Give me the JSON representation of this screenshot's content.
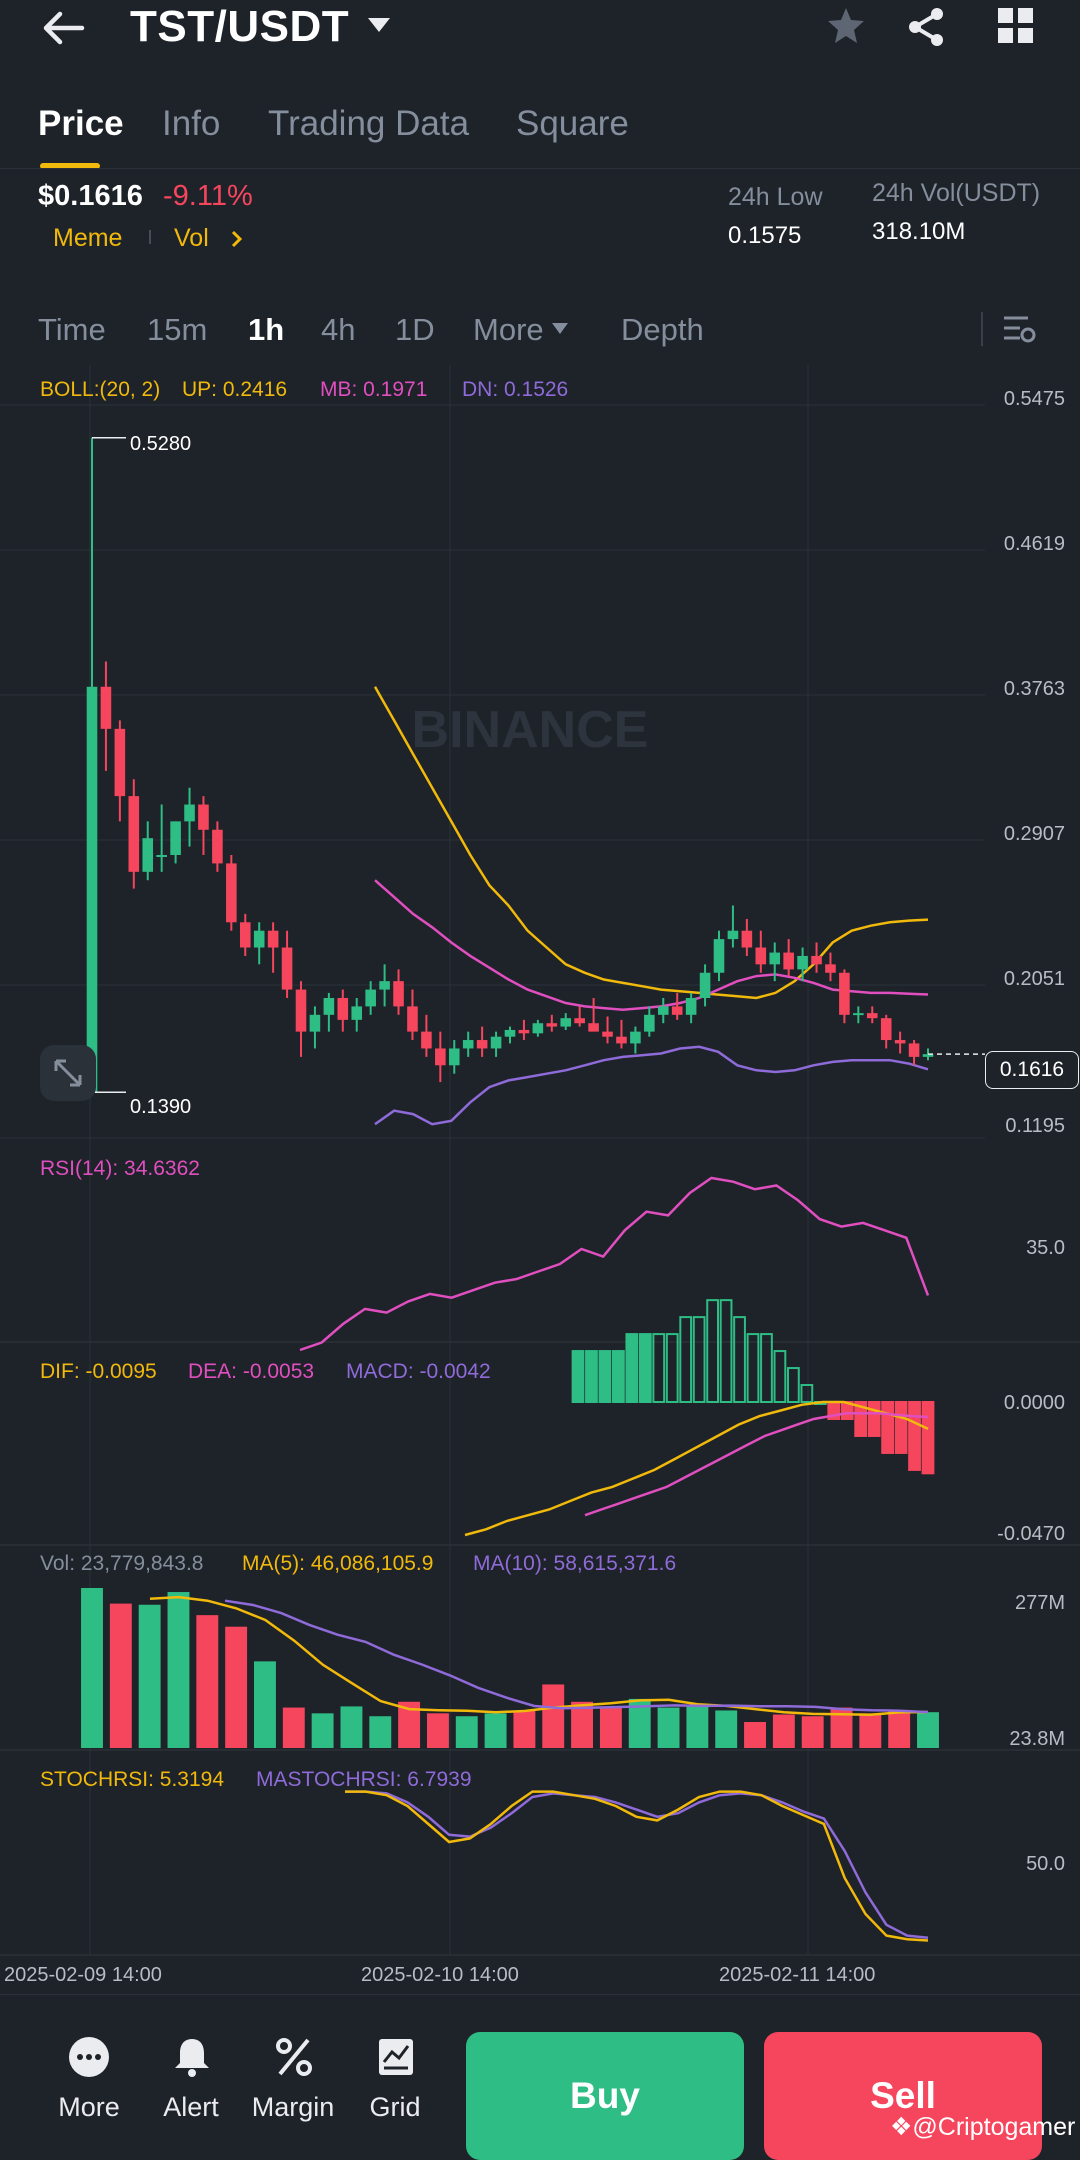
{
  "header": {
    "pair": "TST/USDT",
    "icons": [
      "back-arrow-icon",
      "caret-down-icon",
      "star-icon",
      "share-icon",
      "grid-icon"
    ]
  },
  "tabs": [
    {
      "label": "Price",
      "active": true
    },
    {
      "label": "Info",
      "active": false
    },
    {
      "label": "Trading Data",
      "active": false
    },
    {
      "label": "Square",
      "active": false
    }
  ],
  "ticker": {
    "price": "$0.1616",
    "change": "-9.11%",
    "tag1": "Meme",
    "tag2": "Vol",
    "low_label": "24h Low",
    "low_value": "0.1575",
    "vol_label": "24h Vol(USDT)",
    "vol_value": "318.10M"
  },
  "timeframes": {
    "items": [
      "Time",
      "15m",
      "1h",
      "4h",
      "1D",
      "More",
      "Depth"
    ],
    "active": "1h"
  },
  "indicators": {
    "boll": {
      "label": "BOLL:(20, 2)",
      "up": "UP: 0.2416",
      "mb": "MB: 0.1971",
      "dn": "DN: 0.1526"
    },
    "rsi": "RSI(14): 34.6362",
    "macd": {
      "dif": "DIF: -0.0095",
      "dea": "DEA: -0.0053",
      "macd": "MACD: -0.0042"
    },
    "vol": {
      "vol": "Vol: 23,779,843.8",
      "ma5": "MA(5): 46,086,105.9",
      "ma10": "MA(10): 58,615,371.6"
    },
    "stoch": {
      "stoch": "STOCHRSI: 5.3194",
      "ma": "MASTOCHRSI: 6.7939"
    }
  },
  "axis": {
    "price": [
      "0.5475",
      "0.4619",
      "0.3763",
      "0.2907",
      "0.2051",
      "0.1195"
    ],
    "current": "0.1616",
    "high_marker": "0.5280",
    "low_marker": "0.1390",
    "rsi": "35.0",
    "macd_top": "0.0000",
    "macd_bottom": "-0.0470",
    "vol_top": "277M",
    "vol_bottom": "23.8M",
    "stoch": "50.0"
  },
  "dates": [
    "2025-02-09 14:00",
    "2025-02-10 14:00",
    "2025-02-11 14:00"
  ],
  "watermark": "BINANCE",
  "bottom_nav": [
    {
      "label": "More",
      "icon": "more-dots-icon"
    },
    {
      "label": "Alert",
      "icon": "bell-icon"
    },
    {
      "label": "Margin",
      "icon": "margin-percent-icon"
    },
    {
      "label": "Grid",
      "icon": "grid-bot-icon"
    }
  ],
  "actions": {
    "buy": "Buy",
    "sell": "Sell"
  },
  "credit": "@Criptogamer",
  "colors": {
    "up": "#2ebd85",
    "down": "#f6465d",
    "accent": "#f0b90b",
    "boll_mb": "#e04fbf",
    "boll_dn": "#8e6bd8"
  },
  "chart_data": {
    "type": "candlestick",
    "x_labels": [
      "2025-02-09 14:00",
      "2025-02-10 14:00",
      "2025-02-11 14:00"
    ],
    "ylim": [
      0.1195,
      0.5475
    ],
    "candles": [
      [
        0.139,
        0.528,
        0.139,
        0.38
      ],
      [
        0.38,
        0.395,
        0.33,
        0.355
      ],
      [
        0.355,
        0.36,
        0.3,
        0.315
      ],
      [
        0.315,
        0.325,
        0.26,
        0.27
      ],
      [
        0.27,
        0.3,
        0.265,
        0.29
      ],
      [
        0.28,
        0.31,
        0.27,
        0.28
      ],
      [
        0.28,
        0.3,
        0.275,
        0.3
      ],
      [
        0.3,
        0.32,
        0.285,
        0.31
      ],
      [
        0.31,
        0.315,
        0.28,
        0.295
      ],
      [
        0.295,
        0.3,
        0.27,
        0.275
      ],
      [
        0.275,
        0.28,
        0.235,
        0.24
      ],
      [
        0.24,
        0.245,
        0.22,
        0.225
      ],
      [
        0.225,
        0.24,
        0.215,
        0.235
      ],
      [
        0.235,
        0.24,
        0.21,
        0.225
      ],
      [
        0.225,
        0.235,
        0.195,
        0.2
      ],
      [
        0.2,
        0.205,
        0.16,
        0.175
      ],
      [
        0.175,
        0.19,
        0.165,
        0.185
      ],
      [
        0.185,
        0.198,
        0.175,
        0.195
      ],
      [
        0.195,
        0.2,
        0.175,
        0.182
      ],
      [
        0.182,
        0.195,
        0.175,
        0.19
      ],
      [
        0.19,
        0.205,
        0.185,
        0.2
      ],
      [
        0.2,
        0.215,
        0.19,
        0.205
      ],
      [
        0.205,
        0.212,
        0.185,
        0.19
      ],
      [
        0.19,
        0.2,
        0.17,
        0.175
      ],
      [
        0.175,
        0.185,
        0.16,
        0.165
      ],
      [
        0.165,
        0.175,
        0.145,
        0.155
      ],
      [
        0.155,
        0.17,
        0.15,
        0.165
      ],
      [
        0.165,
        0.175,
        0.16,
        0.17
      ],
      [
        0.17,
        0.178,
        0.16,
        0.165
      ],
      [
        0.165,
        0.175,
        0.16,
        0.172
      ],
      [
        0.172,
        0.178,
        0.168,
        0.176
      ],
      [
        0.176,
        0.182,
        0.17,
        0.174
      ],
      [
        0.174,
        0.182,
        0.172,
        0.18
      ],
      [
        0.18,
        0.185,
        0.175,
        0.178
      ],
      [
        0.178,
        0.186,
        0.176,
        0.183
      ],
      [
        0.183,
        0.19,
        0.178,
        0.18
      ],
      [
        0.18,
        0.195,
        0.178,
        0.175
      ],
      [
        0.175,
        0.184,
        0.168,
        0.172
      ],
      [
        0.172,
        0.182,
        0.165,
        0.168
      ],
      [
        0.168,
        0.178,
        0.162,
        0.175
      ],
      [
        0.175,
        0.19,
        0.172,
        0.185
      ],
      [
        0.185,
        0.195,
        0.18,
        0.19
      ],
      [
        0.19,
        0.198,
        0.182,
        0.185
      ],
      [
        0.185,
        0.198,
        0.18,
        0.195
      ],
      [
        0.195,
        0.215,
        0.19,
        0.21
      ],
      [
        0.21,
        0.235,
        0.205,
        0.23
      ],
      [
        0.23,
        0.25,
        0.225,
        0.235
      ],
      [
        0.235,
        0.242,
        0.22,
        0.225
      ],
      [
        0.225,
        0.235,
        0.21,
        0.215
      ],
      [
        0.215,
        0.228,
        0.205,
        0.222
      ],
      [
        0.222,
        0.23,
        0.208,
        0.212
      ],
      [
        0.212,
        0.225,
        0.205,
        0.22
      ],
      [
        0.22,
        0.228,
        0.21,
        0.215
      ],
      [
        0.215,
        0.222,
        0.205,
        0.21
      ],
      [
        0.21,
        0.212,
        0.18,
        0.185
      ],
      [
        0.185,
        0.19,
        0.18,
        0.186
      ],
      [
        0.186,
        0.19,
        0.18,
        0.183
      ],
      [
        0.183,
        0.185,
        0.165,
        0.17
      ],
      [
        0.17,
        0.175,
        0.162,
        0.168
      ],
      [
        0.168,
        0.17,
        0.155,
        0.16
      ],
      [
        0.16,
        0.165,
        0.158,
        0.1616
      ]
    ],
    "boll_upper": [
      0.38,
      0.36,
      0.34,
      0.32,
      0.3,
      0.28,
      0.262,
      0.25,
      0.235,
      0.225,
      0.215,
      0.21,
      0.206,
      0.204,
      0.202,
      0.2,
      0.199,
      0.198,
      0.197,
      0.196,
      0.195,
      0.198,
      0.205,
      0.215,
      0.228,
      0.235,
      0.238,
      0.24,
      0.241,
      0.2416
    ],
    "boll_mid": [
      0.265,
      0.255,
      0.245,
      0.237,
      0.228,
      0.22,
      0.213,
      0.206,
      0.2,
      0.196,
      0.192,
      0.19,
      0.189,
      0.188,
      0.189,
      0.19,
      0.192,
      0.195,
      0.2,
      0.205,
      0.208,
      0.209,
      0.207,
      0.204,
      0.2,
      0.199,
      0.198,
      0.198,
      0.1975,
      0.1971
    ],
    "boll_lower": [
      0.12,
      0.128,
      0.126,
      0.12,
      0.122,
      0.133,
      0.142,
      0.146,
      0.148,
      0.15,
      0.152,
      0.155,
      0.158,
      0.16,
      0.161,
      0.162,
      0.165,
      0.166,
      0.163,
      0.155,
      0.152,
      0.151,
      0.152,
      0.155,
      0.157,
      0.158,
      0.158,
      0.158,
      0.156,
      0.1526
    ],
    "rsi": [
      20,
      22,
      27,
      31,
      30,
      33,
      35,
      34,
      36,
      38,
      39,
      41,
      43,
      47,
      45,
      52,
      57,
      56,
      62,
      66,
      65,
      63,
      64,
      60,
      55,
      53,
      54,
      52,
      50,
      34.6
    ],
    "macd_dif": [
      -0.047,
      -0.045,
      -0.042,
      -0.04,
      -0.038,
      -0.035,
      -0.032,
      -0.03,
      -0.027,
      -0.024,
      -0.02,
      -0.016,
      -0.012,
      -0.008,
      -0.005,
      -0.003,
      -0.001,
      0.0,
      0.0,
      -0.002,
      -0.004,
      -0.006,
      -0.0095
    ],
    "macd_dea": [
      -0.04,
      -0.038,
      -0.036,
      -0.034,
      -0.032,
      -0.03,
      -0.027,
      -0.024,
      -0.021,
      -0.018,
      -0.015,
      -0.012,
      -0.01,
      -0.008,
      -0.006,
      -0.005,
      -0.004,
      -0.004,
      -0.004,
      -0.0045,
      -0.005,
      -0.0053
    ],
    "macd_hist": [
      0.003,
      0.003,
      0.003,
      0.003,
      0.004,
      0.004,
      0.004,
      0.004,
      0.005,
      0.005,
      0.006,
      0.006,
      0.005,
      0.004,
      0.004,
      0.003,
      0.002,
      0.001,
      0.0,
      -0.001,
      -0.001,
      -0.002,
      -0.002,
      -0.003,
      -0.003,
      -0.004,
      -0.0042
    ],
    "volume_m": [
      277,
      250,
      248,
      270,
      230,
      210,
      150,
      70,
      60,
      72,
      55,
      80,
      60,
      55,
      60,
      65,
      110,
      80,
      72,
      85,
      70,
      72,
      65,
      45,
      58,
      55,
      70,
      60,
      65,
      62
    ],
    "stochrsi": [
      88,
      88,
      86,
      80,
      70,
      60,
      62,
      70,
      80,
      88,
      88,
      86,
      84,
      80,
      74,
      72,
      78,
      85,
      88,
      88,
      86,
      80,
      75,
      70,
      40,
      20,
      8,
      6,
      5.3
    ],
    "mastochrsi": [
      88,
      88,
      87,
      82,
      74,
      64,
      63,
      68,
      76,
      85,
      87,
      86,
      85,
      82,
      78,
      74,
      76,
      82,
      86,
      87,
      86,
      82,
      77,
      73,
      55,
      32,
      14,
      8,
      6.8
    ]
  }
}
